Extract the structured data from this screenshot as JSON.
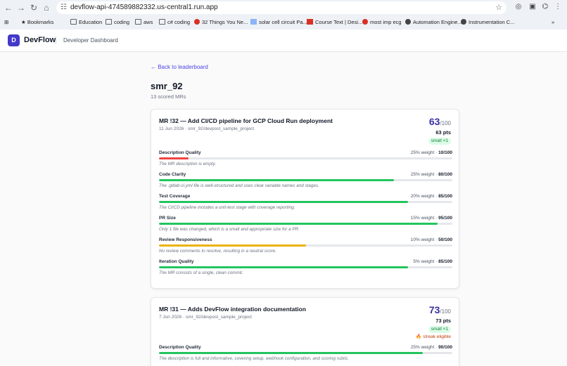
{
  "browser": {
    "url": "devflow-api-474589882332.us-central1.run.app",
    "bookmarks": [
      {
        "label": "Bookmarks",
        "icon": "star-icon"
      },
      {
        "label": "Education",
        "icon": "folder-icon"
      },
      {
        "label": "coding",
        "icon": "folder-icon"
      },
      {
        "label": "aws",
        "icon": "folder-icon"
      },
      {
        "label": "c# coding",
        "icon": "folder-icon"
      },
      {
        "label": "32 Things You Ne...",
        "icon": "site-icon"
      },
      {
        "label": "solar cell circuit Pa...",
        "icon": "site-icon"
      },
      {
        "label": "Course Text | Desi...",
        "icon": "site-icon"
      },
      {
        "label": "most imp ecg",
        "icon": "site-icon"
      },
      {
        "label": "Automation Engine...",
        "icon": "site-icon"
      },
      {
        "label": "Instrumentation C...",
        "icon": "site-icon"
      }
    ]
  },
  "header": {
    "logo_letter": "D",
    "brand": "DevFlow",
    "subtitle": "Developer Dashboard"
  },
  "page": {
    "back_link": "← Back to leaderboard",
    "username": "smr_92",
    "mr_count": "13 scored MRs"
  },
  "colors": {
    "red": "#ef4444",
    "green": "#22c55e",
    "yellow": "#eab308",
    "accent": "#3730a3"
  },
  "mrs": [
    {
      "title": "MR !32 — Add CI/CD pipeline for GCP Cloud Run deployment",
      "meta": "11 Jun 2026 · smr_92/devpost_sample_project",
      "score": "63",
      "score_max": "/100",
      "pts": "63 pts",
      "badge": "small ×1",
      "streak": "",
      "metrics": [
        {
          "name": "Description Quality",
          "weight": "25% weight · ",
          "score": "10/100",
          "value": 10,
          "color": "red",
          "desc": "The MR description is empty."
        },
        {
          "name": "Code Clarity",
          "weight": "25% weight · ",
          "score": "80/100",
          "value": 80,
          "color": "green",
          "desc": "The .gitlab-ci.yml file is well-structured and uses clear variable names and stages."
        },
        {
          "name": "Test Coverage",
          "weight": "20% weight · ",
          "score": "85/100",
          "value": 85,
          "color": "green",
          "desc": "The CI/CD pipeline includes a unit-test stage with coverage reporting."
        },
        {
          "name": "PR Size",
          "weight": "15% weight · ",
          "score": "95/100",
          "value": 95,
          "color": "green",
          "desc": "Only 1 file was changed, which is a small and appropriate size for a PR."
        },
        {
          "name": "Review Responsiveness",
          "weight": "10% weight · ",
          "score": "50/100",
          "value": 50,
          "color": "yellow",
          "desc": "No review comments to resolve, resulting in a neutral score."
        },
        {
          "name": "Iteration Quality",
          "weight": "5% weight · ",
          "score": "85/100",
          "value": 85,
          "color": "green",
          "desc": "The MR consists of a single, clean commit."
        }
      ]
    },
    {
      "title": "MR !31 — Adds DevFlow integration documentation",
      "meta": "7 Jun 2026 · smr_92/devpost_sample_project",
      "score": "73",
      "score_max": "/100",
      "pts": "73 pts",
      "badge": "small ×1",
      "streak": "🔥 streak eligible",
      "metrics": [
        {
          "name": "Description Quality",
          "weight": "25% weight · ",
          "score": "90/100",
          "value": 90,
          "color": "green",
          "desc": "The description is full and informative, covering setup, webhook configuration, and scoring rubric."
        }
      ]
    }
  ]
}
